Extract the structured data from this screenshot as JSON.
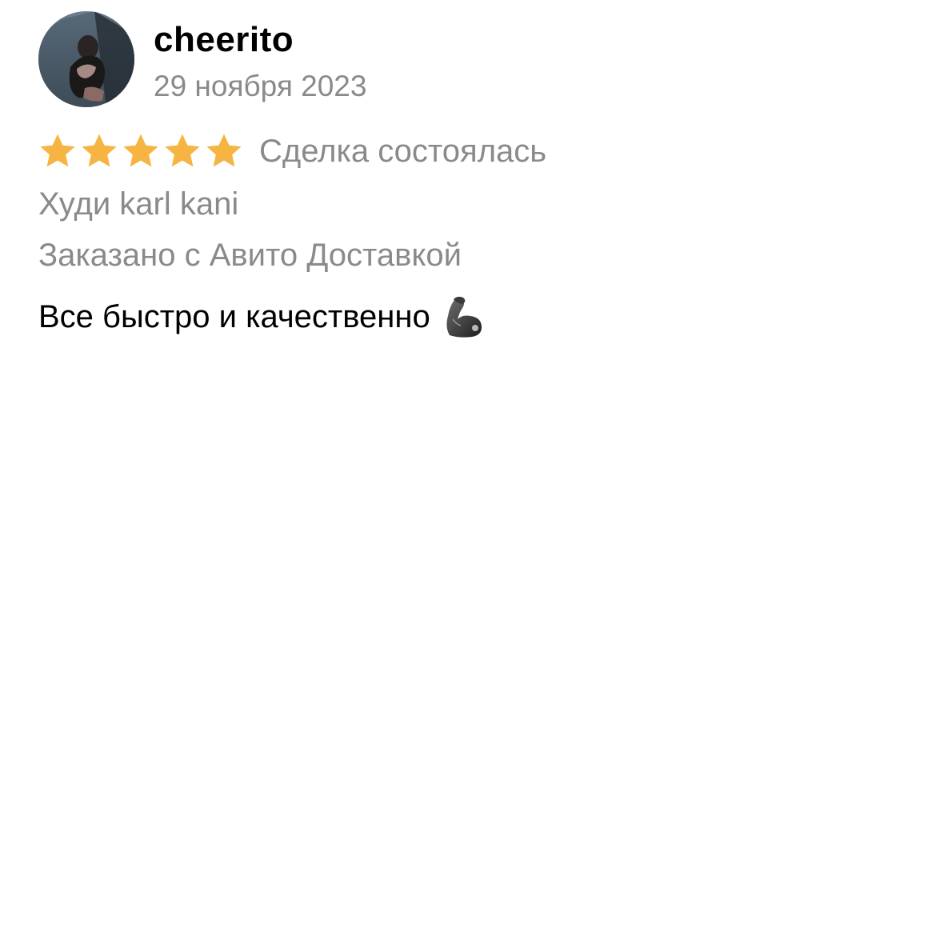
{
  "review": {
    "author": {
      "username": "cheerito",
      "avatar_icon": "user-photo-avatar"
    },
    "date": "29 ноября 2023",
    "rating": {
      "value": 5,
      "max": 5,
      "star_color": "#F6B443"
    },
    "deal_status": "Сделка состоялась",
    "item_title": "Худи karl kani",
    "delivery_note": "Заказано с Авито Доставкой",
    "comment": "Все быстро и качественно",
    "comment_emoji_icon": "flexed-biceps-icon"
  }
}
